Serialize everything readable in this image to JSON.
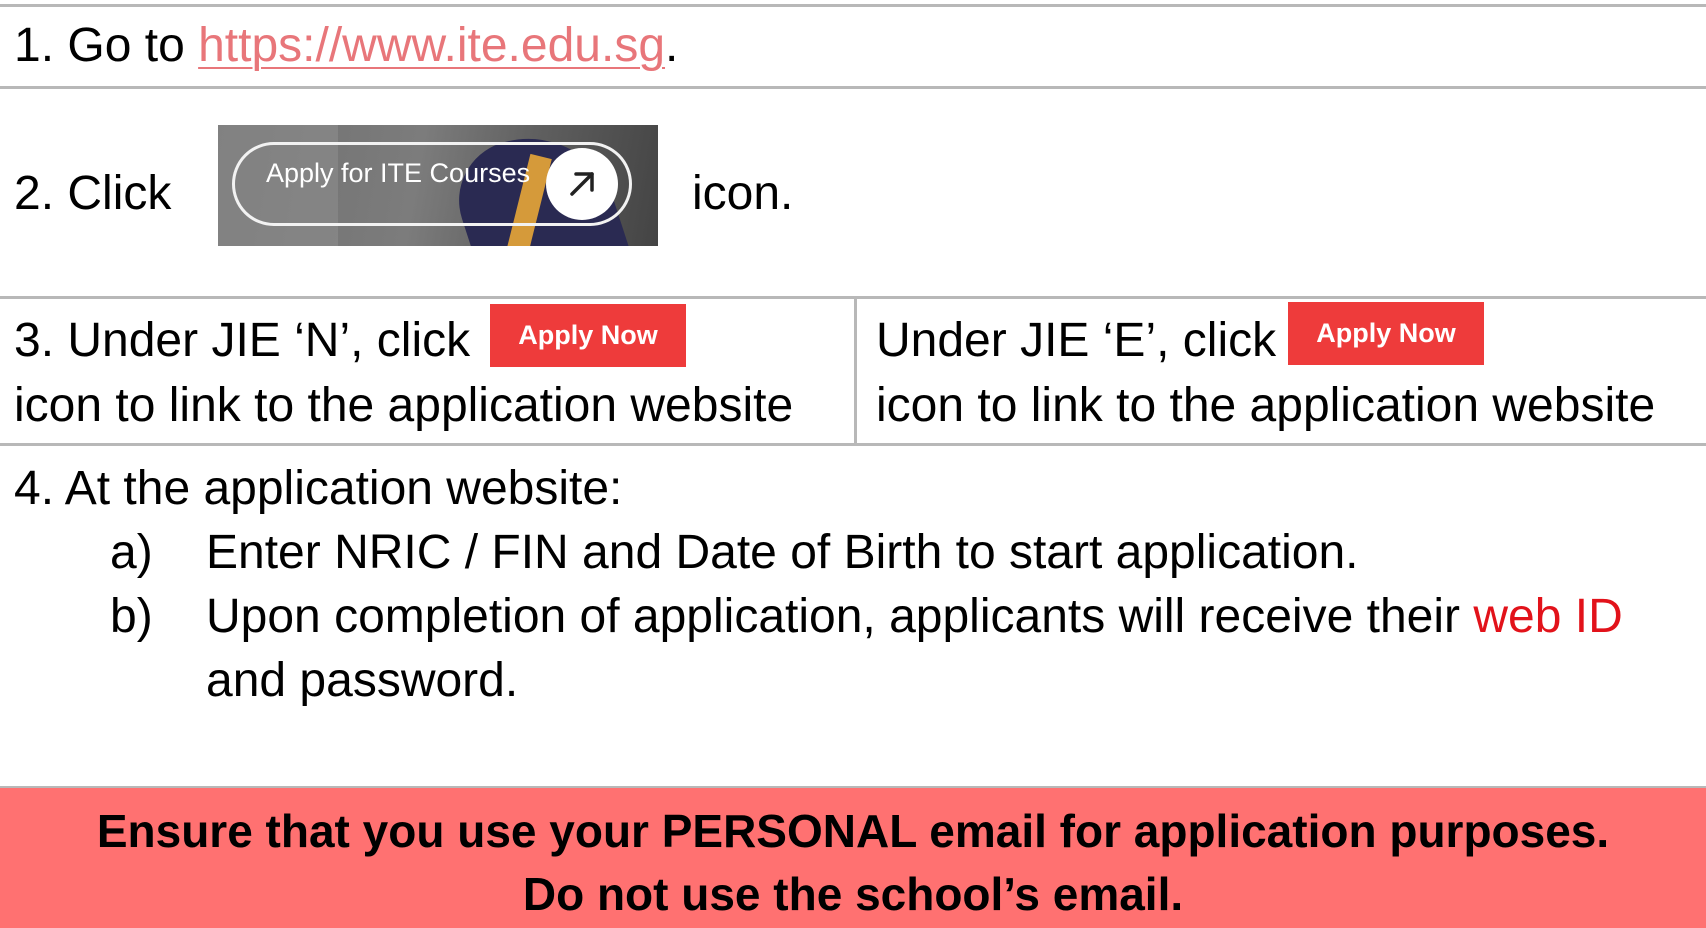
{
  "step1": {
    "prefix": "1.  Go to ",
    "url": "https://www.ite.edu.sg",
    "suffix": "."
  },
  "step2": {
    "prefix": "2. Click",
    "button_label": "Apply for ITE Courses",
    "suffix": "icon."
  },
  "step3": {
    "left": {
      "line1": "3. Under JIE ‘N’, click",
      "button_label": "Apply Now",
      "line2": "icon to link to the application website"
    },
    "right": {
      "line1": "Under JIE ‘E’, click",
      "button_label": "Apply Now",
      "line2": "icon to link to the application website"
    }
  },
  "step4": {
    "heading": "4. At the application website:",
    "items": [
      {
        "marker": "a)",
        "text": "Enter NRIC / FIN and Date of Birth to start application."
      },
      {
        "marker": "b)",
        "text_before": "Upon completion of application, applicants will receive their ",
        "highlight": "web ID",
        "text_after": "and password."
      }
    ]
  },
  "notice": {
    "line1": "Ensure that you use your PERSONAL email for application purposes.",
    "line2": "Do not use the school’s email."
  },
  "colors": {
    "link": "#e8767a",
    "highlight": "#e2121a",
    "apply_button": "#ee3b3b",
    "notice_background": "#ff7171",
    "divider": "#b8b8b8"
  },
  "icons": {
    "arrow": "arrow-up-right-icon"
  }
}
